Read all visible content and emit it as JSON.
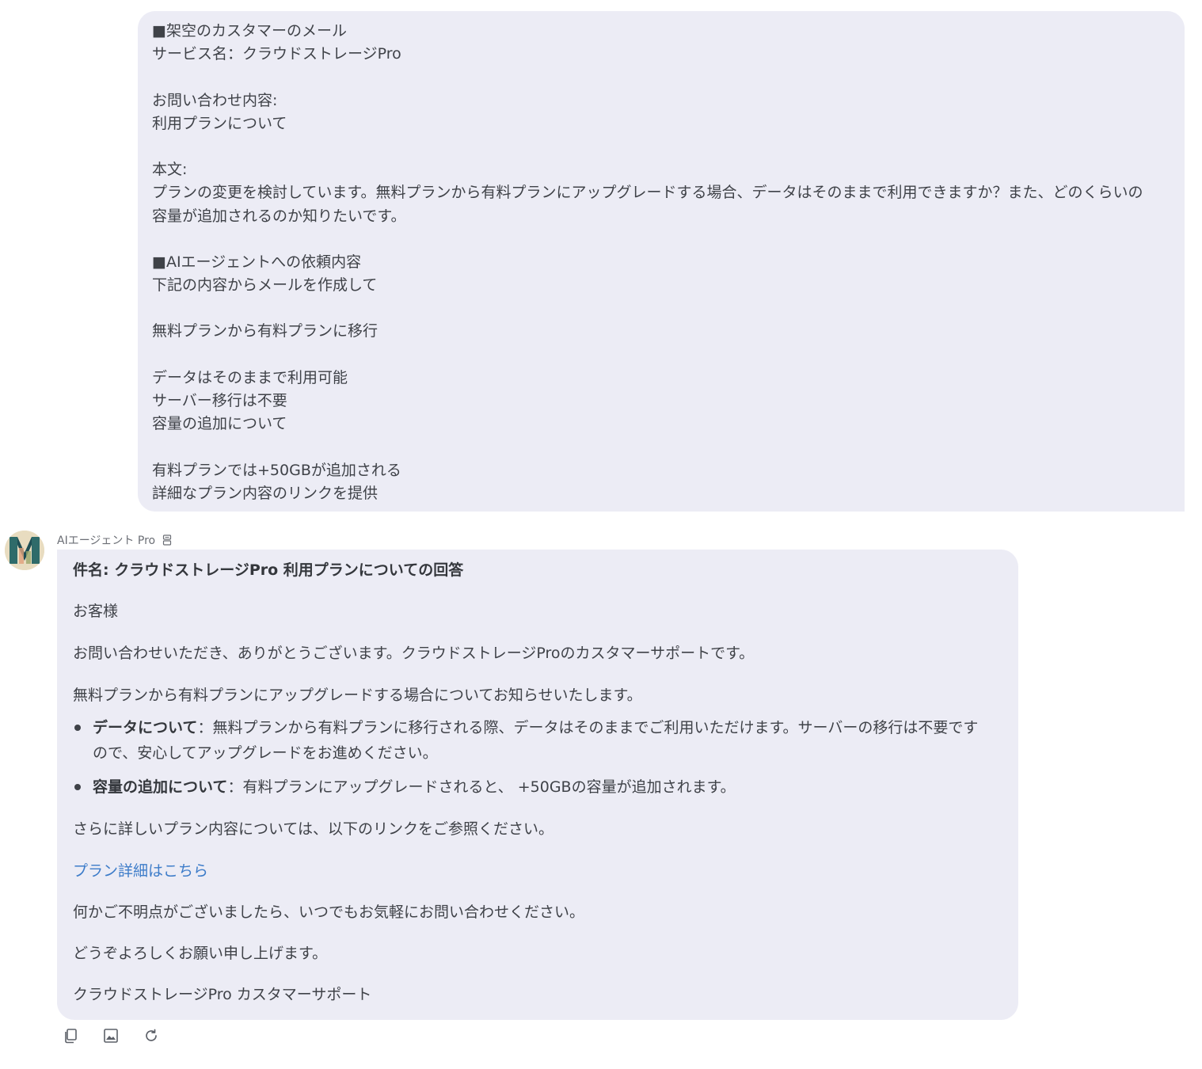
{
  "user_message": {
    "lines": [
      "■架空のカスタマーのメール",
      "サービス名：クラウドストレージPro",
      "",
      "お問い合わせ内容:",
      "利用プランについて",
      "",
      "本文:",
      "プランの変更を検討しています。無料プランから有料プランにアップグレードする場合、データはそのままで利用できますか？また、どのくらいの",
      "容量が追加されるのか知りたいです。",
      "",
      "■AIエージェントへの依頼内容",
      "下記の内容からメールを作成して",
      "",
      "無料プランから有料プランに移行",
      "",
      "データはそのままで利用可能",
      "サーバー移行は不要",
      "容量の追加について",
      "",
      "有料プランでは+50GBが追加される",
      "詳細なプラン内容のリンクを提供"
    ]
  },
  "agent": {
    "name": "AIエージェント Pro",
    "badge_icon": "agent-badge-icon"
  },
  "agent_message": {
    "subject": "件名: クラウドストレージPro 利用プランについての回答",
    "greeting": "お客様",
    "intro": "お問い合わせいただき、ありがとうございます。クラウドストレージProのカスタマーサポートです。",
    "lead": "無料プランから有料プランにアップグレードする場合についてお知らせいたします。",
    "bullets": [
      {
        "title": "データについて",
        "text": "：無料プランから有料プランに移行される際、データはそのままでご利用いただけます。サーバーの移行は不要ですので、安心してアップグレードをお進めください。"
      },
      {
        "title": "容量の追加について",
        "text": "：有料プランにアップグレードされると、 +50GBの容量が追加されます。"
      }
    ],
    "more_info": "さらに詳しいプラン内容については、以下のリンクをご参照ください。",
    "link_text": "プラン詳細はこちら",
    "closing": "何かご不明点がございましたら、いつでもお気軽にお問い合わせください。",
    "regards": "どうぞよろしくお願い申し上げます。",
    "signature": "クラウドストレージPro カスタマーサポート"
  },
  "actions": {
    "icons": [
      "copy-icon",
      "image-icon",
      "regenerate-icon"
    ]
  }
}
